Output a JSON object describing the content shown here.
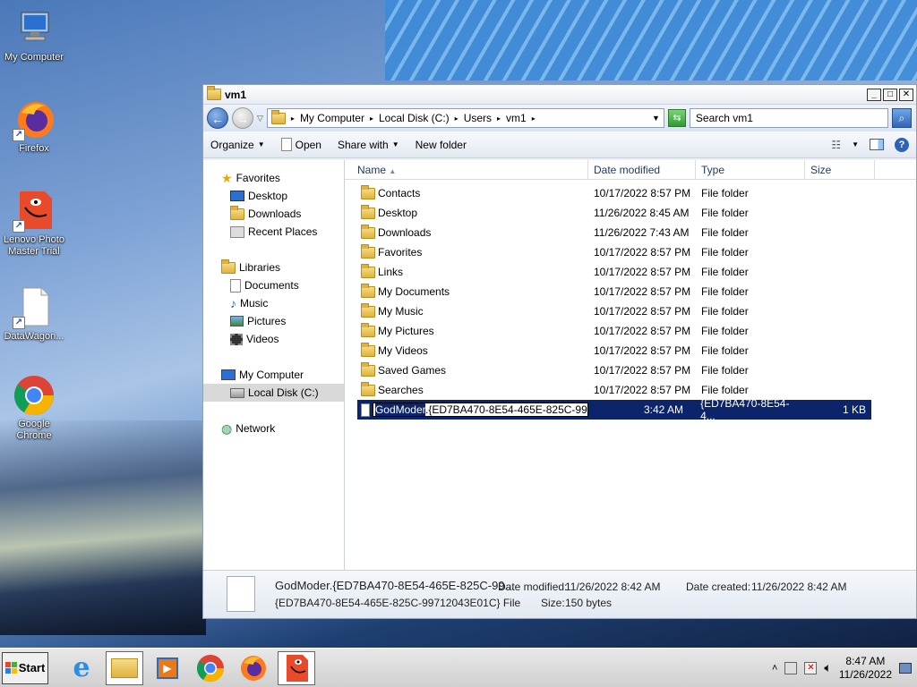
{
  "desktop": {
    "icons": [
      {
        "label": "My Computer"
      },
      {
        "label": "Firefox"
      },
      {
        "label": "Lenovo Photo Master Trial"
      },
      {
        "label": "DataWagon..."
      },
      {
        "label": "Google Chrome"
      }
    ]
  },
  "window": {
    "title": "vm1",
    "address": [
      "My Computer",
      "Local Disk (C:)",
      "Users",
      "vm1"
    ],
    "search_placeholder": "Search vm1",
    "toolbar": {
      "organize": "Organize",
      "open": "Open",
      "share_with": "Share with",
      "new_folder": "New folder"
    },
    "nav": {
      "favorites": "Favorites",
      "favorites_items": [
        "Desktop",
        "Downloads",
        "Recent Places"
      ],
      "libraries": "Libraries",
      "libraries_items": [
        "Documents",
        "Music",
        "Pictures",
        "Videos"
      ],
      "computer": "My Computer",
      "computer_items": [
        "Local Disk (C:)"
      ],
      "network": "Network"
    },
    "columns": {
      "name": "Name",
      "date": "Date modified",
      "type": "Type",
      "size": "Size"
    },
    "rows": [
      {
        "name": "Contacts",
        "date": "10/17/2022 8:57 PM",
        "type": "File folder"
      },
      {
        "name": "Desktop",
        "date": "11/26/2022 8:45 AM",
        "type": "File folder"
      },
      {
        "name": "Downloads",
        "date": "11/26/2022 7:43 AM",
        "type": "File folder"
      },
      {
        "name": "Favorites",
        "date": "10/17/2022 8:57 PM",
        "type": "File folder"
      },
      {
        "name": "Links",
        "date": "10/17/2022 8:57 PM",
        "type": "File folder"
      },
      {
        "name": "My Documents",
        "date": "10/17/2022 8:57 PM",
        "type": "File folder"
      },
      {
        "name": "My Music",
        "date": "10/17/2022 8:57 PM",
        "type": "File folder"
      },
      {
        "name": "My Pictures",
        "date": "10/17/2022 8:57 PM",
        "type": "File folder"
      },
      {
        "name": "My Videos",
        "date": "10/17/2022 8:57 PM",
        "type": "File folder"
      },
      {
        "name": "Saved Games",
        "date": "10/17/2022 8:57 PM",
        "type": "File folder"
      },
      {
        "name": "Searches",
        "date": "10/17/2022 8:57 PM",
        "type": "File folder"
      }
    ],
    "renaming": {
      "selected_part": "GodModer",
      "rest": ".{ED7BA470-8E54-465E-825C-99712043E01C}",
      "date_tail": "3:42 AM",
      "type": "{ED7BA470-8E54-4...",
      "size": "1 KB"
    },
    "details": {
      "name": "GodModer.{ED7BA470-8E54-465E-825C-99...",
      "type_line": "{ED7BA470-8E54-465E-825C-99712043E01C} File",
      "date_modified_label": "Date modified:",
      "date_modified": "11/26/2022 8:42 AM",
      "date_created_label": "Date created:",
      "date_created": "11/26/2022 8:42 AM",
      "size_label": "Size:",
      "size": "150 bytes"
    }
  },
  "taskbar": {
    "start": "Start",
    "time": "8:47 AM",
    "date": "11/26/2022"
  }
}
